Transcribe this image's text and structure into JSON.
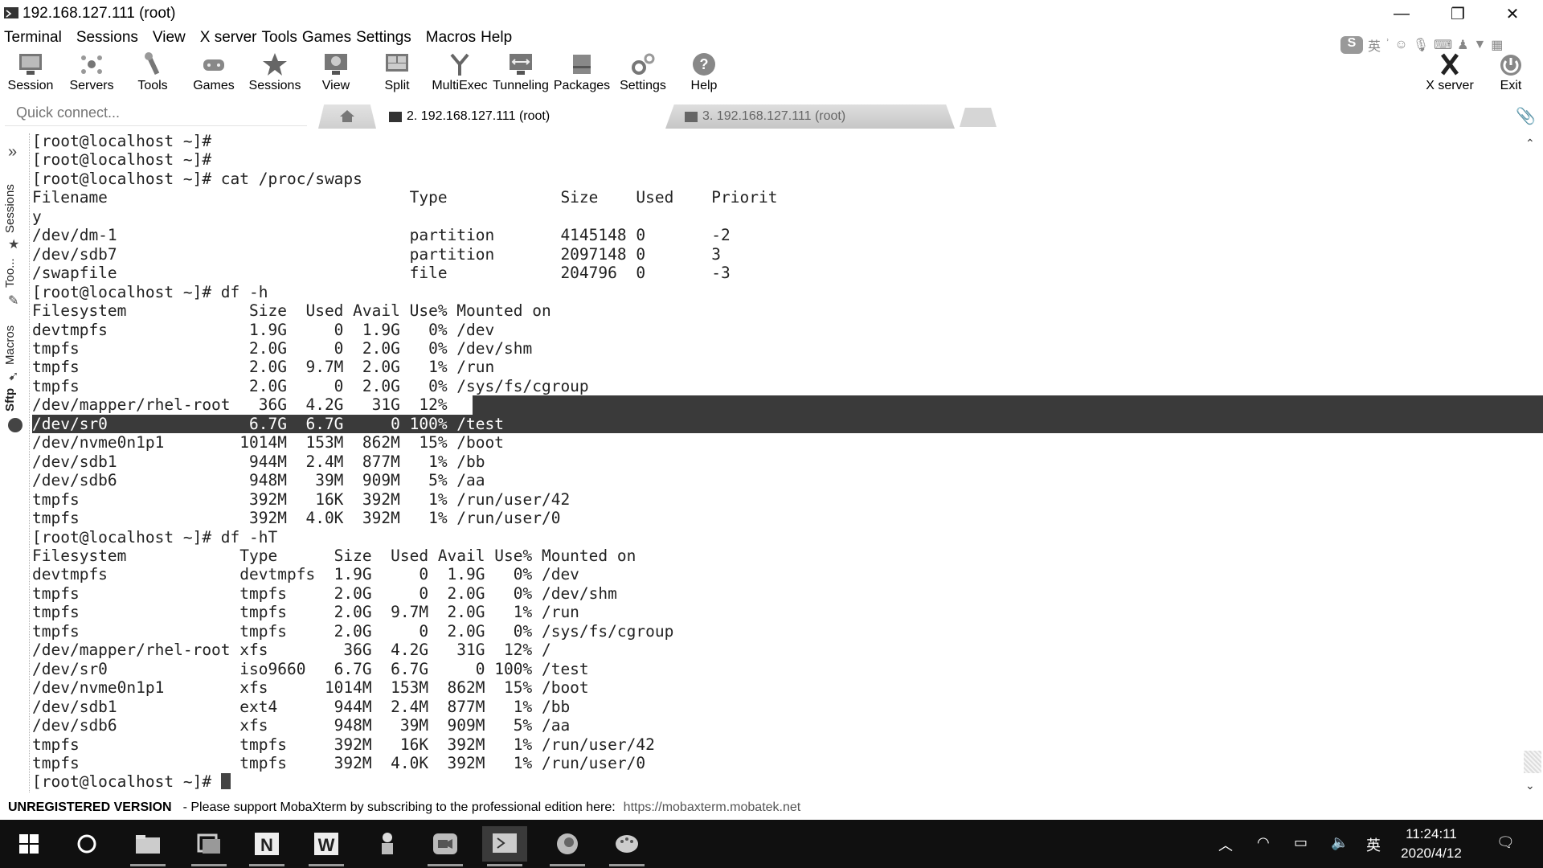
{
  "window": {
    "title": "192.168.127.111 (root)",
    "minimize_glyph": "—",
    "restore_glyph": "❐",
    "close_glyph": "✕"
  },
  "menu": [
    "Terminal",
    "Sessions",
    "View",
    "X server",
    "Tools",
    "Games",
    "Settings",
    "Macros",
    "Help"
  ],
  "toolbar": {
    "session": "Session",
    "servers": "Servers",
    "tools": "Tools",
    "games": "Games",
    "sessions": "Sessions",
    "view": "View",
    "split": "Split",
    "multiexec": "MultiExec",
    "tunneling": "Tunneling",
    "packages": "Packages",
    "settings": "Settings",
    "help": "Help",
    "xserver": "X server",
    "exit": "Exit"
  },
  "ime_bar": {
    "lang": "英"
  },
  "quick_connect": {
    "placeholder": "Quick connect..."
  },
  "tabs": {
    "tab1": "2. 192.168.127.111 (root)",
    "tab2": "3. 192.168.127.111 (root)"
  },
  "sidebar": {
    "sessions": "Sessions",
    "tools": "Too...",
    "macros": "Macros",
    "sftp": "Sftp"
  },
  "terminal": {
    "lines": [
      "[root@localhost ~]#",
      "[root@localhost ~]#",
      "[root@localhost ~]# cat /proc/swaps",
      "Filename                                Type            Size    Used    Priorit",
      "y",
      "/dev/dm-1                               partition       4145148 0       -2",
      "/dev/sdb7                               partition       2097148 0       3",
      "/swapfile                               file            204796  0       -3",
      "[root@localhost ~]# df -h",
      "Filesystem             Size  Used Avail Use% Mounted on",
      "devtmpfs               1.9G     0  1.9G   0% /dev",
      "tmpfs                  2.0G     0  2.0G   0% /dev/shm",
      "tmpfs                  2.0G  9.7M  2.0G   1% /run",
      "tmpfs                  2.0G     0  2.0G   0% /sys/fs/cgroup"
    ],
    "line_root_a": "/dev/mapper/rhel-root   36G  4.2G   31G  12% ",
    "line_root_b": "/",
    "line_sr0": "/dev/sr0               6.7G  6.7G     0 100% /test",
    "lines_after": [
      "/dev/nvme0n1p1        1014M  153M  862M  15% /boot",
      "/dev/sdb1              944M  2.4M  877M   1% /bb",
      "/dev/sdb6              948M   39M  909M   5% /aa",
      "tmpfs                  392M   16K  392M   1% /run/user/42",
      "tmpfs                  392M  4.0K  392M   1% /run/user/0",
      "[root@localhost ~]# df -hT",
      "Filesystem            Type      Size  Used Avail Use% Mounted on",
      "devtmpfs              devtmpfs  1.9G     0  1.9G   0% /dev",
      "tmpfs                 tmpfs     2.0G     0  2.0G   0% /dev/shm",
      "tmpfs                 tmpfs     2.0G  9.7M  2.0G   1% /run",
      "tmpfs                 tmpfs     2.0G     0  2.0G   0% /sys/fs/cgroup",
      "/dev/mapper/rhel-root xfs        36G  4.2G   31G  12% /",
      "/dev/sr0              iso9660   6.7G  6.7G     0 100% /test",
      "/dev/nvme0n1p1        xfs      1014M  153M  862M  15% /boot",
      "/dev/sdb1             ext4      944M  2.4M  877M   1% /bb",
      "/dev/sdb6             xfs       948M   39M  909M   5% /aa",
      "tmpfs                 tmpfs     392M   16K  392M   1% /run/user/42",
      "tmpfs                 tmpfs     392M  4.0K  392M   1% /run/user/0"
    ],
    "prompt": "[root@localhost ~]# "
  },
  "status": {
    "unregistered": "UNREGISTERED VERSION",
    "message": "-  Please support MobaXterm by subscribing to the professional edition here:",
    "link": "https://mobaxterm.mobatek.net"
  },
  "taskbar": {
    "ime": "英",
    "time": "11:24:11",
    "date": "2020/4/12"
  },
  "colors": {
    "selection": "#3a3a3a",
    "taskbar": "#101010",
    "terminal_text": "#222222"
  }
}
